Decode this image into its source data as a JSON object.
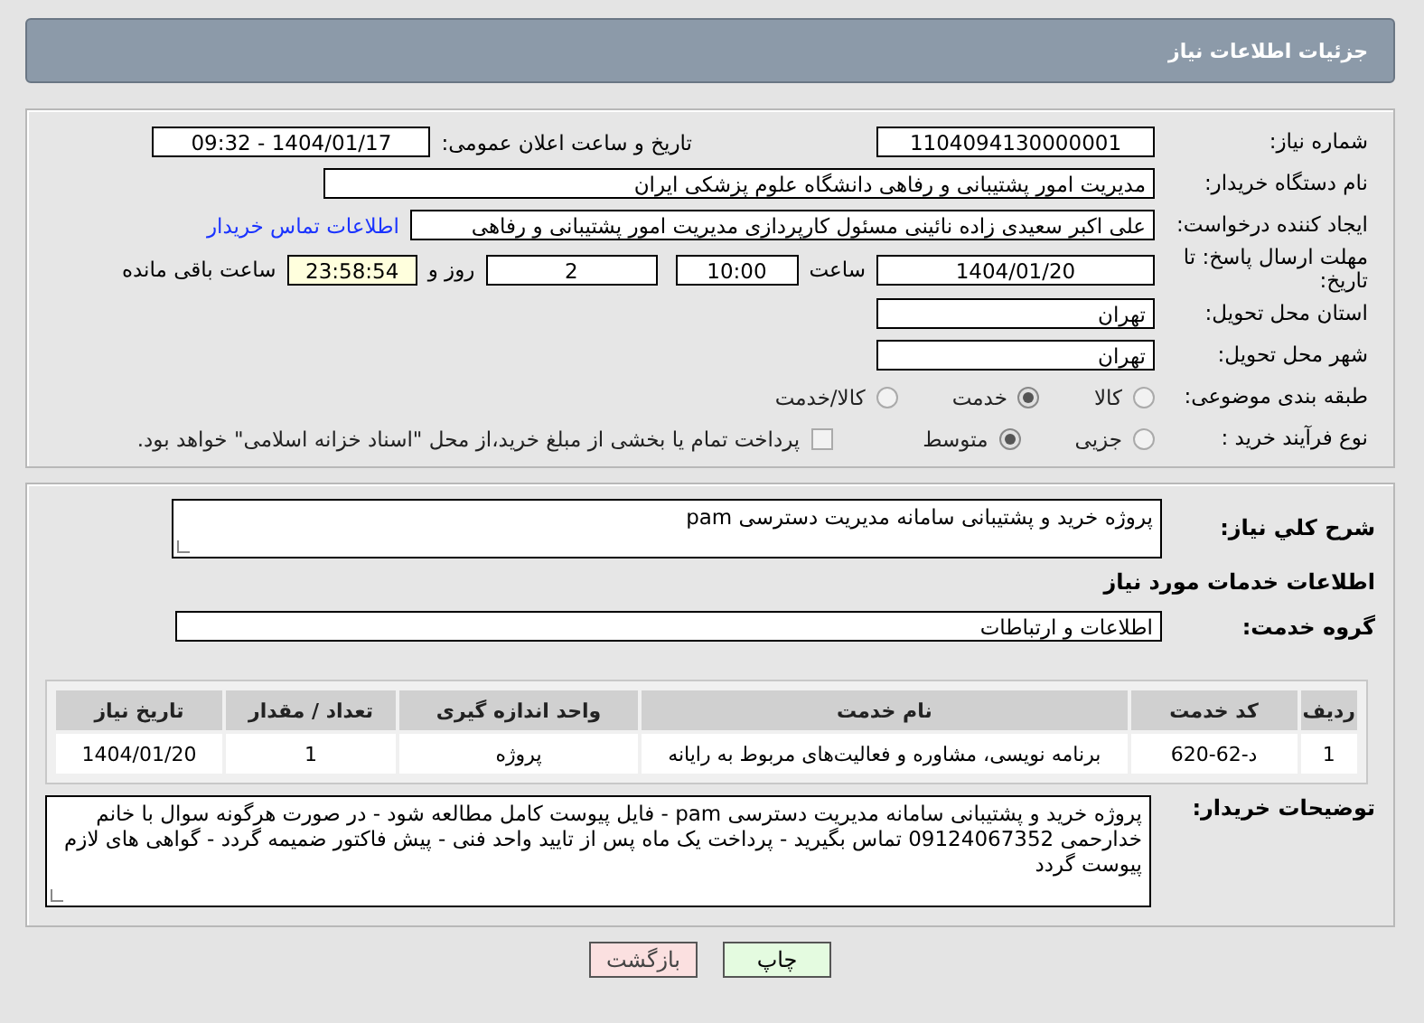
{
  "header": {
    "title": "جزئیات اطلاعات نیاز"
  },
  "need_number": {
    "label": "شماره نیاز:",
    "value": "1104094130000001"
  },
  "announce": {
    "label": "تاریخ و ساعت اعلان عمومی:",
    "value": "1404/01/17 - 09:32"
  },
  "buyer_org": {
    "label": "نام دستگاه خریدار:",
    "value": "مدیریت امور پشتیبانی و رفاهی دانشگاه علوم پزشکی ایران"
  },
  "requester": {
    "label": "ایجاد کننده درخواست:",
    "value": "علی اکبر سعیدی زاده نائینی مسئول کارپردازی مدیریت امور پشتیبانی و رفاهی",
    "link": "اطلاعات تماس خریدار"
  },
  "deadline": {
    "label": "مهلت ارسال پاسخ: تا تاریخ:",
    "date": "1404/01/20",
    "time_label": "ساعت",
    "time": "10:00",
    "days": "2",
    "days_label": "روز و",
    "remaining": "23:58:54",
    "remaining_label": "ساعت باقی مانده"
  },
  "province": {
    "label": "استان محل تحویل:",
    "value": "تهران"
  },
  "city": {
    "label": "شهر محل تحویل:",
    "value": "تهران"
  },
  "category": {
    "label": "طبقه بندی موضوعی:",
    "options": [
      {
        "label": "کالا",
        "selected": false
      },
      {
        "label": "خدمت",
        "selected": true
      },
      {
        "label": "کالا/خدمت",
        "selected": false
      }
    ]
  },
  "process": {
    "label": "نوع فرآیند خرید :",
    "options": [
      {
        "label": "جزیی",
        "selected": false
      },
      {
        "label": "متوسط",
        "selected": true
      }
    ],
    "checkbox": {
      "checked": false,
      "text": "پرداخت تمام یا بخشی از مبلغ خرید،از محل \"اسناد خزانه اسلامی\" خواهد بود."
    }
  },
  "description": {
    "label": "شرح کلي نیاز:",
    "value": "پروژه خرید و پشتیبانی سامانه مدیریت دسترسی  pam"
  },
  "services_heading": "اطلاعات خدمات مورد نیاز",
  "service_group": {
    "label": "گروه خدمت:",
    "value": "اطلاعات و ارتباطات"
  },
  "table": {
    "columns": [
      "ردیف",
      "کد خدمت",
      "نام خدمت",
      "واحد اندازه گیری",
      "تعداد / مقدار",
      "تاریخ نیاز"
    ],
    "rows": [
      [
        "1",
        "د-62-620",
        "برنامه نویسی، مشاوره و فعالیت‌های مربوط به رایانه",
        "پروژه",
        "1",
        "1404/01/20"
      ]
    ]
  },
  "buyer_notes": {
    "label": "توضیحات خریدار:",
    "value": "پروژه خرید و پشتیبانی سامانه مدیریت دسترسی  pam  - فایل پیوست کامل مطالعه شود - در صورت هرگونه سوال  با خانم خدارحمی 09124067352 تماس بگیرید - پرداخت یک ماه پس از تایید واحد فنی - پیش فاکتور ضمیمه گردد - گواهی های لازم پیوست گردد"
  },
  "buttons": [
    {
      "label": "چاپ",
      "kind": "print"
    },
    {
      "label": "بازگشت",
      "kind": "back"
    }
  ]
}
